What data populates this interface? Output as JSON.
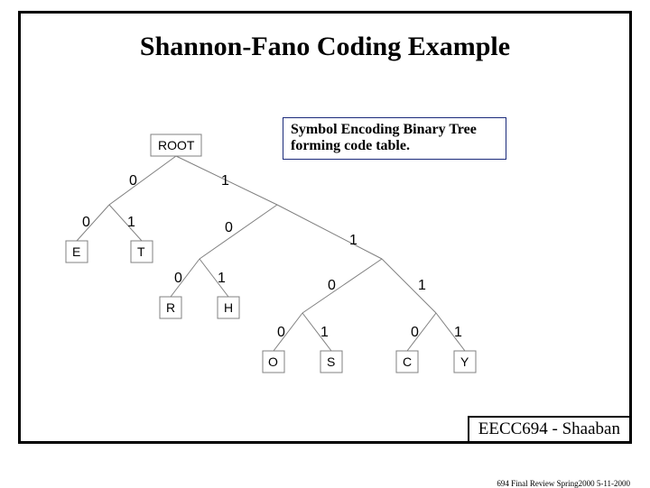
{
  "title": "Shannon-Fano Coding Example",
  "callout": {
    "line1": "Symbol Encoding Binary Tree",
    "line2": "forming code table."
  },
  "nodes": {
    "root": "ROOT",
    "E": "E",
    "T": "T",
    "R": "R",
    "H": "H",
    "O": "O",
    "S": "S",
    "C": "C",
    "Y": "Y"
  },
  "edge_labels": {
    "L0_left": "0",
    "L0_right": "1",
    "L1_left_left": "0",
    "L1_left_right": "1",
    "L1_right_left": "0",
    "L1_right_right": "1",
    "L2_rl_left": "0",
    "L2_rl_right": "1",
    "L2_rr_left": "0",
    "L2_rr_right": "1",
    "L3_rrl_left": "0",
    "L3_rrl_right": "1",
    "L3_rrr_left": "0",
    "L3_rrr_right": "1"
  },
  "chart_data": {
    "type": "tree",
    "root": {
      "label": "ROOT",
      "children": [
        {
          "edge": "0",
          "children": [
            {
              "edge": "0",
              "symbol": "E",
              "code": "00"
            },
            {
              "edge": "1",
              "symbol": "T",
              "code": "01"
            }
          ]
        },
        {
          "edge": "1",
          "children": [
            {
              "edge": "0",
              "children": [
                {
                  "edge": "0",
                  "symbol": "R",
                  "code": "100"
                },
                {
                  "edge": "1",
                  "symbol": "H",
                  "code": "101"
                }
              ]
            },
            {
              "edge": "1",
              "children": [
                {
                  "edge": "0",
                  "children": [
                    {
                      "edge": "0",
                      "symbol": "O",
                      "code": "1100"
                    },
                    {
                      "edge": "1",
                      "symbol": "S",
                      "code": "1101"
                    }
                  ]
                },
                {
                  "edge": "1",
                  "children": [
                    {
                      "edge": "0",
                      "symbol": "C",
                      "code": "1110"
                    },
                    {
                      "edge": "1",
                      "symbol": "Y",
                      "code": "1111"
                    }
                  ]
                }
              ]
            }
          ]
        }
      ]
    },
    "code_table": [
      {
        "symbol": "E",
        "code": "00"
      },
      {
        "symbol": "T",
        "code": "01"
      },
      {
        "symbol": "R",
        "code": "100"
      },
      {
        "symbol": "H",
        "code": "101"
      },
      {
        "symbol": "O",
        "code": "1100"
      },
      {
        "symbol": "S",
        "code": "1101"
      },
      {
        "symbol": "C",
        "code": "1110"
      },
      {
        "symbol": "Y",
        "code": "1111"
      }
    ]
  },
  "footer": {
    "course": "EECC694 - Shaaban",
    "sub": "694 Final Review   Spring2000    5-11-2000"
  }
}
